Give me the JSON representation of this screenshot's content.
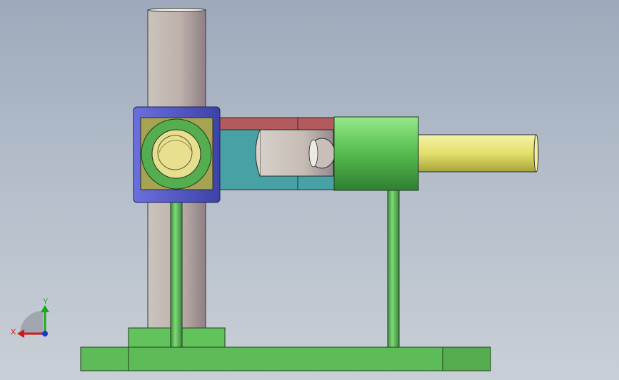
{
  "viewport": {
    "model": "linkage-assembly",
    "parts": [
      "base-plate",
      "column-foot",
      "vertical-column",
      "support-rod-left",
      "support-rod-right",
      "pivot-block",
      "crank-arm",
      "piston",
      "cylinder-body",
      "piston-rod"
    ]
  },
  "triad": {
    "x_label": "X",
    "y_label": "Y",
    "x_color": "#d01818",
    "y_color": "#18a818",
    "z_color": "#1838d0"
  },
  "colors": {
    "background_top": "#9ea9bb",
    "background_bottom": "#c9cfd6",
    "green_part": "#5fbf5a",
    "column": "#bfb4ad",
    "pivot_block_frame": "#5a5fc8",
    "pivot_block_face": "#a8a653",
    "crank_top": "#b85a5a",
    "crank_body": "#48a3a6",
    "piston_rod": "#e6e27a"
  }
}
